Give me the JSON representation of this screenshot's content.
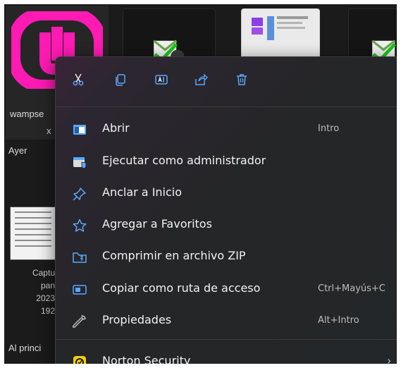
{
  "background": {
    "app_tile_label_line1": "wampse",
    "app_tile_label_line2": "x",
    "group_label_yesterday": "Ayer",
    "caption_lines": [
      "Captu",
      "pan",
      "2023",
      "192"
    ],
    "group_label_beginning": "Al princi"
  },
  "context_menu": {
    "quick_actions": [
      {
        "icon": "scissors-icon",
        "action": "cut"
      },
      {
        "icon": "copy-icon",
        "action": "copy"
      },
      {
        "icon": "rename-icon",
        "action": "rename"
      },
      {
        "icon": "share-icon",
        "action": "share"
      },
      {
        "icon": "trash-icon",
        "action": "delete"
      }
    ],
    "items": [
      {
        "label": "Abrir",
        "shortcut": "Intro",
        "icon": "open-window-icon"
      },
      {
        "label": "Ejecutar como administrador",
        "shortcut": "",
        "icon": "admin-shield-icon"
      },
      {
        "label": "Anclar a Inicio",
        "shortcut": "",
        "icon": "pin-icon"
      },
      {
        "label": "Agregar a Favoritos",
        "shortcut": "",
        "icon": "star-icon"
      },
      {
        "label": "Comprimir en archivo ZIP",
        "shortcut": "",
        "icon": "zip-folder-icon"
      },
      {
        "label": "Copiar como ruta de acceso",
        "shortcut": "Ctrl+Mayús+C",
        "icon": "path-icon"
      },
      {
        "label": "Propiedades",
        "shortcut": "Alt+Intro",
        "icon": "wrench-icon"
      },
      {
        "label": "Norton Security",
        "shortcut": "",
        "submenu_arrow": "›",
        "icon": "norton-icon"
      }
    ]
  },
  "colors": {
    "accent_blue": "#5aa9ff",
    "wamp_pink": "#ff1ab4",
    "norton_yellow": "#f6d000",
    "menu_text": "#f2f2f2"
  }
}
